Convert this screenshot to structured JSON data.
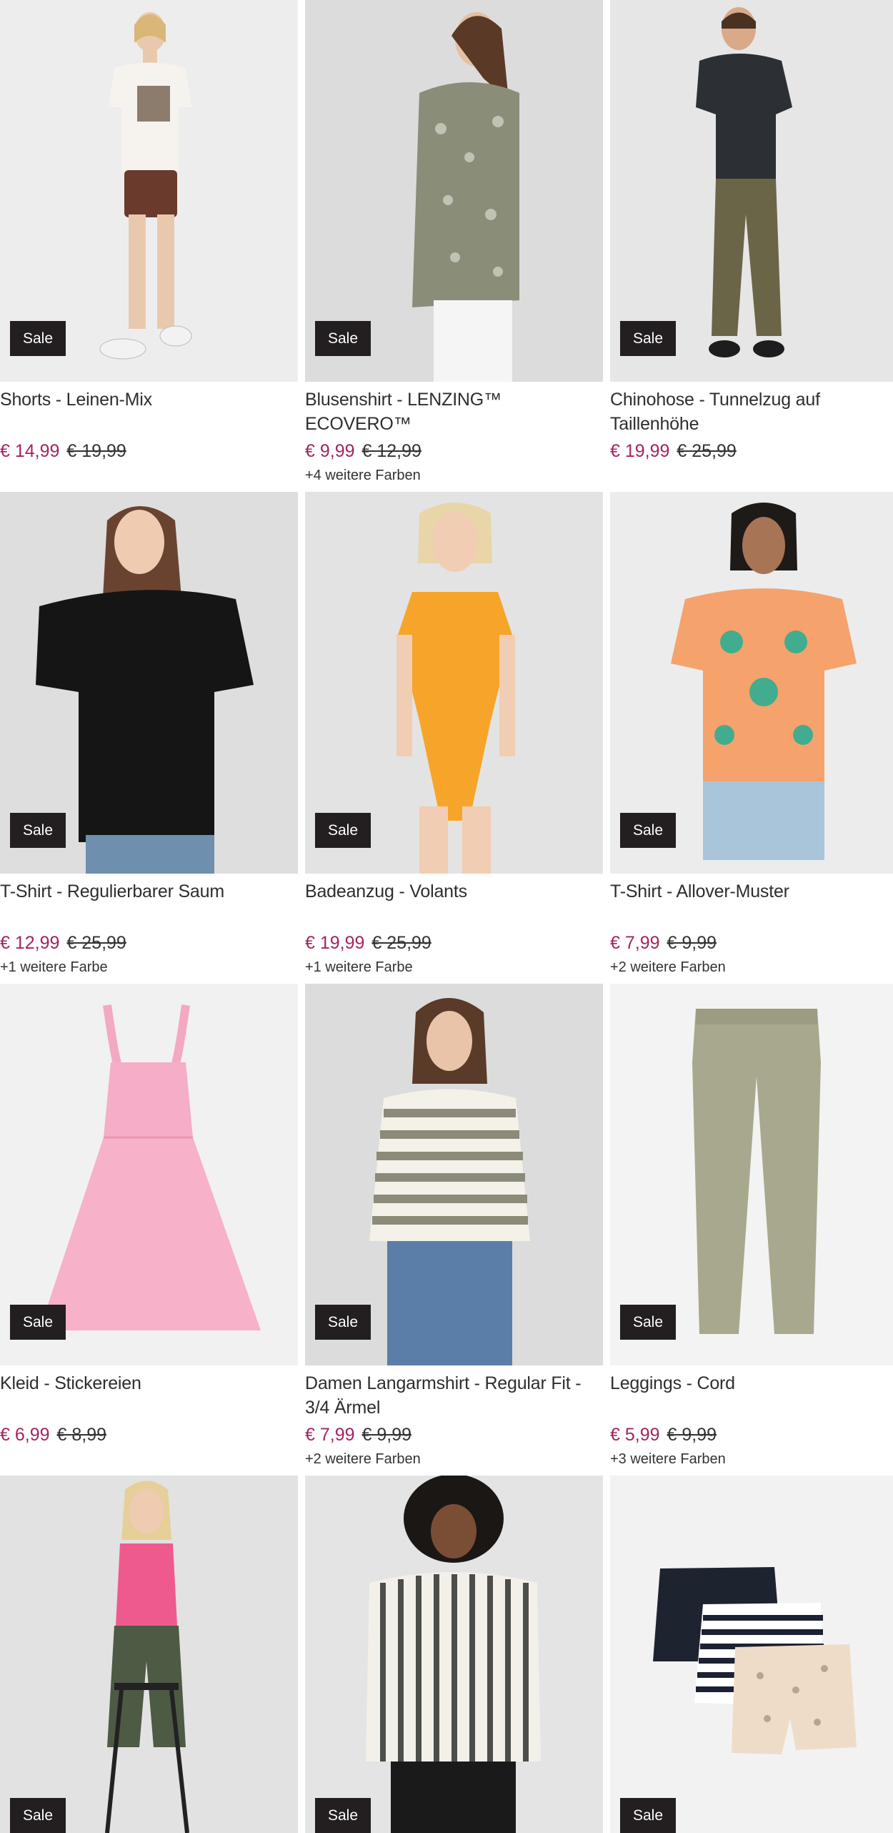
{
  "sale_label": "Sale",
  "colors": {
    "price": "#a3245f",
    "badge": "#231f20"
  },
  "products": [
    {
      "title": "Shorts - Leinen-Mix",
      "price": "€ 14,99",
      "old_price": "€ 19,99",
      "colors_note": ""
    },
    {
      "title": "Blusenshirt - LENZING™ ECOVERO™",
      "price": "€ 9,99",
      "old_price": "€ 12,99",
      "colors_note": "+4 weitere Farben"
    },
    {
      "title": "Chinohose - Tunnelzug auf Taillenhöhe",
      "price": "€ 19,99",
      "old_price": "€ 25,99",
      "colors_note": ""
    },
    {
      "title": "T-Shirt - Regulierbarer Saum",
      "price": "€ 12,99",
      "old_price": "€ 25,99",
      "colors_note": "+1 weitere Farbe"
    },
    {
      "title": "Badeanzug - Volants",
      "price": "€ 19,99",
      "old_price": "€ 25,99",
      "colors_note": "+1 weitere Farbe"
    },
    {
      "title": "T-Shirt - Allover-Muster",
      "price": "€ 7,99",
      "old_price": "€ 9,99",
      "colors_note": "+2 weitere Farben"
    },
    {
      "title": "Kleid - Stickereien",
      "price": "€ 6,99",
      "old_price": "€ 8,99",
      "colors_note": ""
    },
    {
      "title": "Damen Langarmshirt - Regular Fit - 3/4 Ärmel",
      "price": "€ 7,99",
      "old_price": "€ 9,99",
      "colors_note": "+2 weitere Farben"
    },
    {
      "title": "Leggings - Cord",
      "price": "€ 5,99",
      "old_price": "€ 9,99",
      "colors_note": "+3 weitere Farben"
    },
    {
      "title": "",
      "price": "",
      "old_price": "",
      "colors_note": ""
    },
    {
      "title": "",
      "price": "",
      "old_price": "",
      "colors_note": ""
    },
    {
      "title": "",
      "price": "",
      "old_price": "",
      "colors_note": ""
    }
  ]
}
